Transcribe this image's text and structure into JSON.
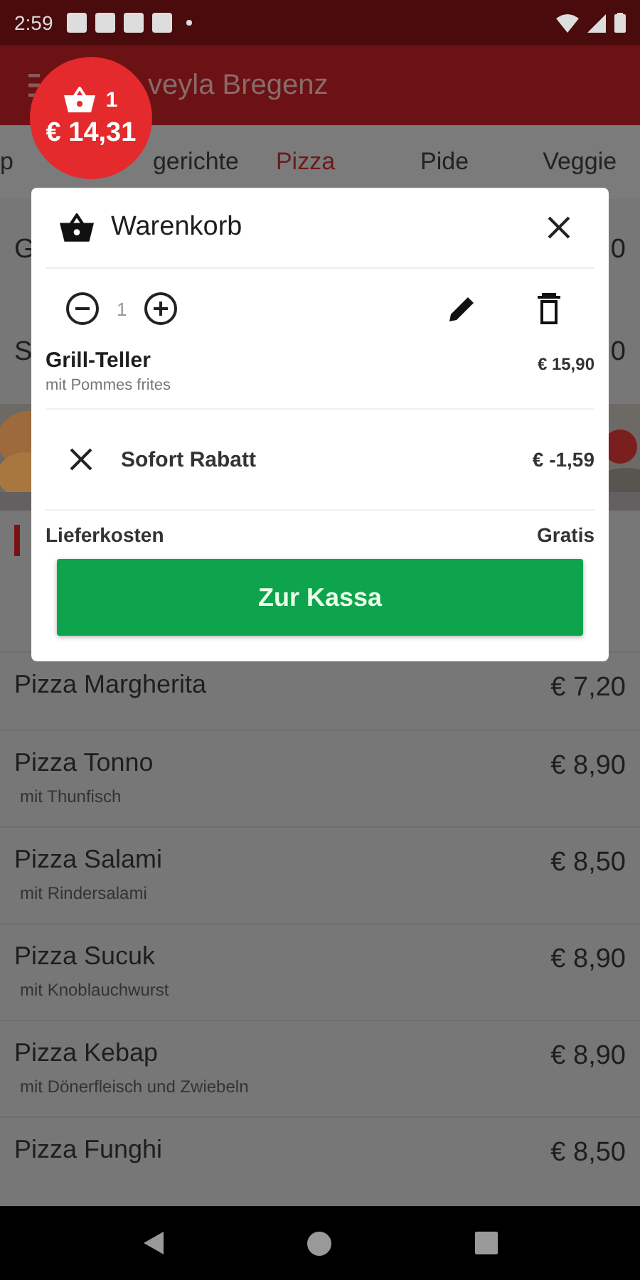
{
  "status_bar": {
    "time": "2:59"
  },
  "app_bar": {
    "title": "veyla Bregenz"
  },
  "cart_badge": {
    "count": "1",
    "total": "€ 14,31"
  },
  "tabs": [
    {
      "label": "p",
      "selected": false
    },
    {
      "label": "gerichte",
      "selected": false
    },
    {
      "label": "Pizza",
      "selected": true
    },
    {
      "label": "Pide",
      "selected": false
    },
    {
      "label": "Veggie",
      "selected": false
    }
  ],
  "covered_rows": [
    {
      "name": "G",
      "price": "0"
    },
    {
      "name": "S",
      "price": "0"
    }
  ],
  "menu_items": [
    {
      "name": "Pizza Margherita",
      "price": "€ 7,20"
    },
    {
      "name": "Pizza Tonno",
      "description": "mit Thunfisch",
      "price": "€ 8,90"
    },
    {
      "name": "Pizza Salami",
      "description": "mit Rindersalami",
      "price": "€ 8,50"
    },
    {
      "name": "Pizza Sucuk",
      "description": "mit Knoblauchwurst",
      "price": "€ 8,90"
    },
    {
      "name": "Pizza Kebap",
      "description": "mit Dönerfleisch und Zwiebeln",
      "price": "€ 8,90"
    },
    {
      "name": "Pizza Funghi",
      "price": "€ 8,50"
    }
  ],
  "cart_dialog": {
    "title": "Warenkorb",
    "item": {
      "quantity": "1",
      "name": "Grill-Teller",
      "description": "mit Pommes frites",
      "price": "€ 15,90"
    },
    "discount": {
      "label": "Sofort Rabatt",
      "amount": "€ -1,59"
    },
    "delivery": {
      "label": "Lieferkosten",
      "value": "Gratis"
    },
    "checkout_button": "Zur Kassa"
  }
}
